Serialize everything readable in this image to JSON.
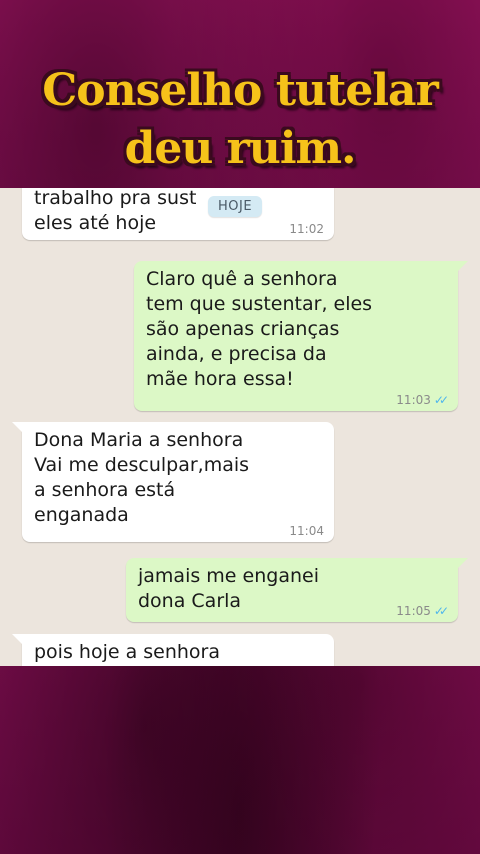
{
  "title": {
    "line1": "Conselho tutelar",
    "line2": "deu ruim."
  },
  "date_chip": "HOJE",
  "messages": [
    {
      "direction": "in",
      "text": "trabalho pra sust\neles até hoje",
      "time": "11:02"
    },
    {
      "direction": "out",
      "text": "Claro quê a senhora\ntem que sustentar, eles\nsão apenas crianças\nainda, e precisa da\nmãe hora essa!",
      "time": "11:03",
      "status": "read"
    },
    {
      "direction": "in",
      "text": "Dona Maria a senhora\nVai me desculpar,mais\na senhora está\nenganada",
      "time": "11:04"
    },
    {
      "direction": "out",
      "text": "jamais me enganei\ndona Carla",
      "time": "11:05",
      "status": "read"
    },
    {
      "direction": "in",
      "text": "pois hoje a senhora",
      "time": ""
    }
  ],
  "colors": {
    "background": "#8e1159",
    "title": "#f6c21a",
    "chat_bg": "#ece5dd",
    "incoming": "#ffffff",
    "outgoing": "#dcf8c6",
    "read_ticks": "#4fb6ec"
  },
  "icons": {
    "read_status": "double-check-icon"
  }
}
